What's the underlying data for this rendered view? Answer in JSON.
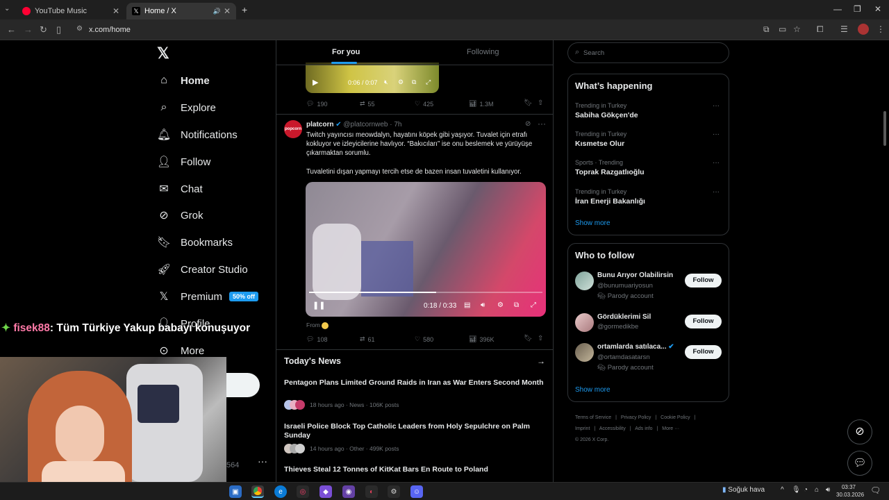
{
  "browser": {
    "tabs": [
      {
        "title": "YouTube Music",
        "active": false
      },
      {
        "title": "Home / X",
        "active": true
      }
    ],
    "url": "x.com/home"
  },
  "nav": {
    "items": [
      {
        "label": "Home",
        "icon": "home-icon"
      },
      {
        "label": "Explore",
        "icon": "search-icon"
      },
      {
        "label": "Notifications",
        "icon": "bell-icon"
      },
      {
        "label": "Follow",
        "icon": "person-plus-icon"
      },
      {
        "label": "Chat",
        "icon": "mail-icon"
      },
      {
        "label": "Grok",
        "icon": "grok-icon"
      },
      {
        "label": "Bookmarks",
        "icon": "bookmark-icon"
      },
      {
        "label": "Creator Studio",
        "icon": "rocket-icon"
      },
      {
        "label": "Premium",
        "icon": "x-logo-icon"
      },
      {
        "label": "Profile",
        "icon": "profile-icon"
      },
      {
        "label": "More",
        "icon": "more-circle-icon"
      }
    ],
    "premium_badge": "50% off",
    "account_count": "564"
  },
  "overlay": {
    "username": "fisek88",
    "message": ": Tüm Türkiye Yakup babayı konuşuyor"
  },
  "feed": {
    "tabs": [
      "For you",
      "Following"
    ],
    "top_video_time": "0:06 / 0:07",
    "top_stats": {
      "replies": "190",
      "reposts": "55",
      "likes": "425",
      "views": "1.3M"
    },
    "post": {
      "author": "platcorn",
      "handle": "@platcornweb",
      "time": "· 7h",
      "text1": "Twitch yayıncısı meowdalyn, hayatını köpek gibi yaşıyor. Tuvalet için etrafı kokluyor ve izleyicilerine havlıyor. “Bakıcıları” ise onu beslemek ve yürüyüşe çıkarmaktan sorumlu.",
      "text2": "Tuvaletini dışan yapmayı tercih etse de bazen insan tuvaletini kullanıyor.",
      "video_time": "0:18 / 0:33",
      "from": "From",
      "stats": {
        "replies": "108",
        "reposts": "61",
        "likes": "580",
        "views": "396K"
      }
    },
    "news": {
      "heading": "Today's News",
      "items": [
        {
          "title": "Pentagon Plans Limited Ground Raids in Iran as War Enters Second Month",
          "meta": "18 hours ago · News · 106K posts"
        },
        {
          "title": "Israeli Police Block Top Catholic Leaders from Holy Sepulchre on Palm Sunday",
          "meta": "14 hours ago · Other · 499K posts"
        },
        {
          "title": "Thieves Steal 12 Tonnes of KitKat Bars En Route to Poland",
          "meta": ""
        }
      ]
    }
  },
  "sidebar": {
    "search_placeholder": "Search",
    "happening_title": "What’s happening",
    "trends": [
      {
        "category": "Trending in Turkey",
        "name": "Sabiha Gökçen'de"
      },
      {
        "category": "Trending in Turkey",
        "name": "Kısmetse Olur"
      },
      {
        "category": "Sports · Trending",
        "name": "Toprak Razgatlıoğlu"
      },
      {
        "category": "Trending in Turkey",
        "name": "İran Enerji Bakanlığı"
      }
    ],
    "show_more": "Show more",
    "who_title": "Who to follow",
    "follow_label": "Follow",
    "suggestions": [
      {
        "name": "Bunu Arıyor Olabilirsin",
        "handle": "@bunumuariyosun",
        "note": "Parody account"
      },
      {
        "name": "Gördüklerimi Sil",
        "handle": "@gormedikbe",
        "note": ""
      },
      {
        "name": "ortamlarda satılaca...",
        "handle": "@ortamdasatarsn",
        "note": "Parody account"
      }
    ],
    "footer": [
      "Terms of Service",
      "Privacy Policy",
      "Cookie Policy",
      "Imprint",
      "Accessibility",
      "Ads info",
      "More ···",
      "© 2026 X Corp."
    ]
  },
  "taskbar": {
    "weather": "Soğuk hava",
    "time": "03:37",
    "date": "30.03.2026"
  },
  "colors": {
    "accent": "#1d9bf0",
    "bg": "#000000",
    "border": "#2f3336"
  }
}
